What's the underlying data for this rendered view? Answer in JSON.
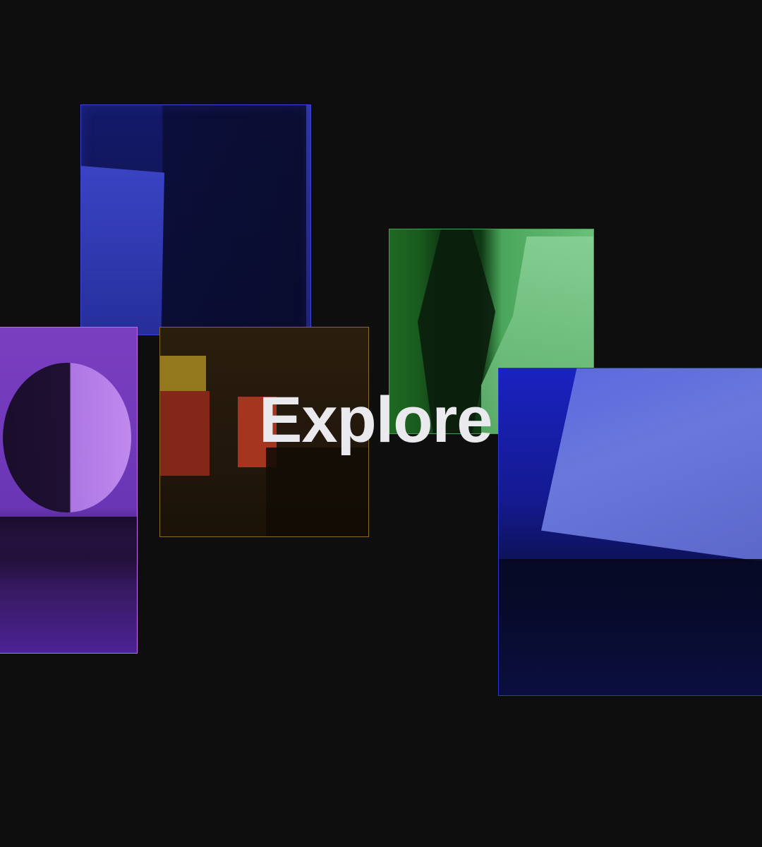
{
  "hero": {
    "title": "Explore"
  },
  "colors": {
    "background": "#0e0e0f",
    "title": "#e9e9ee",
    "blue_pane": "#3c44d8",
    "purple_pane": "#c46ae8",
    "amber_pane": "#8a6a22",
    "green_pane": "#4a9a52",
    "big_blue_pane": "#2a36d6"
  }
}
